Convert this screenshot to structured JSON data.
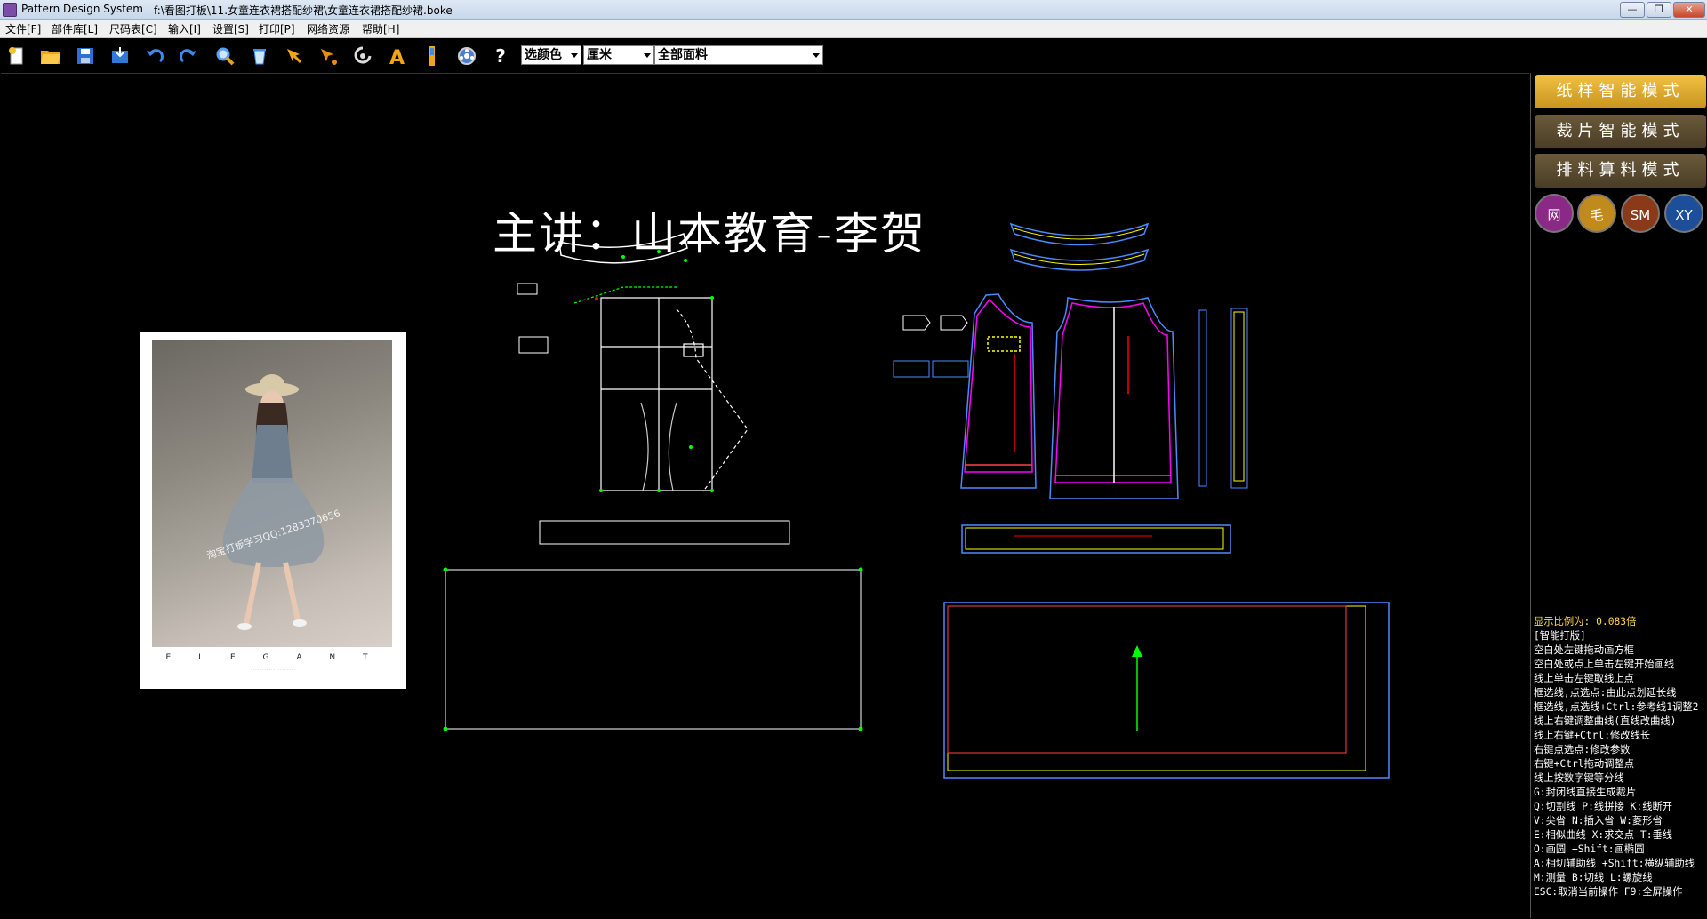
{
  "window": {
    "app_title": "Pattern Design System",
    "file_path": "f:\\看图打板\\11.女童连衣裙搭配纱裙\\女童连衣裙搭配纱裙.boke",
    "minimize": "—",
    "restore": "❐",
    "close": "✕"
  },
  "menu": [
    "文件[F]",
    "部件库[L]",
    "尺码表[C]",
    "输入[I]",
    "设置[S]",
    "打印[P]",
    "网络资源",
    "帮助[H]"
  ],
  "toolbar": {
    "icons": [
      "new-file-icon",
      "open-folder-icon",
      "save-icon",
      "import-icon",
      "undo-icon",
      "redo-icon",
      "zoom-icon",
      "delete-icon",
      "select-arrow-icon",
      "select-point-icon",
      "measure-icon",
      "text-icon",
      "ruler-icon",
      "settings-wheel-icon"
    ],
    "help_label": "?",
    "color_select": "选颜色",
    "unit_select": "厘米",
    "fabric_select": "全部面料"
  },
  "canvas": {
    "headline": "主讲：山本教育-李贺",
    "photo_brand": "E L E G A N T",
    "photo_watermark": "淘宝打板学习QQ:1283370656"
  },
  "colors": {
    "mode_button": "#c8941e",
    "circle_wang": "#8a2a86",
    "circle_mao": "#c08a1c",
    "circle_sm": "#8a3a18",
    "circle_xy": "#1c4e9a"
  },
  "right_panel": {
    "modes": [
      "纸样智能模式",
      "裁片智能模式",
      "排料算料模式"
    ],
    "circles": [
      "网",
      "毛",
      "SM",
      "XY"
    ],
    "scale_label": "显示比例为: 0.083倍",
    "help_lines": [
      "    [智能打版]",
      "空白处左键拖动画方框",
      "空白处或点上单击左键开始画线",
      "线上单击左键取线上点",
      "框选线,点选点:由此点划延长线",
      "框选线,点选线+Ctrl:参考线1调整2",
      "线上右键调整曲线(直线改曲线)",
      "线上右键+Ctrl:修改线长",
      "右键点选点:修改参数",
      "右键+Ctrl拖动调整点",
      "线上按数字键等分线",
      "G:封闭线直接生成裁片",
      "Q:切割线  P:线拼接  K:线断开",
      "V:尖省  N:插入省  W:菱形省",
      "E:相似曲线  X:求交点  T:垂线",
      "O:画圆 +Shift:画椭圆",
      "A:相切辅助线 +Shift:横纵辅助线",
      "M:测量  B:切线  L:螺旋线",
      "ESC:取消当前操作  F9:全屏操作"
    ]
  }
}
